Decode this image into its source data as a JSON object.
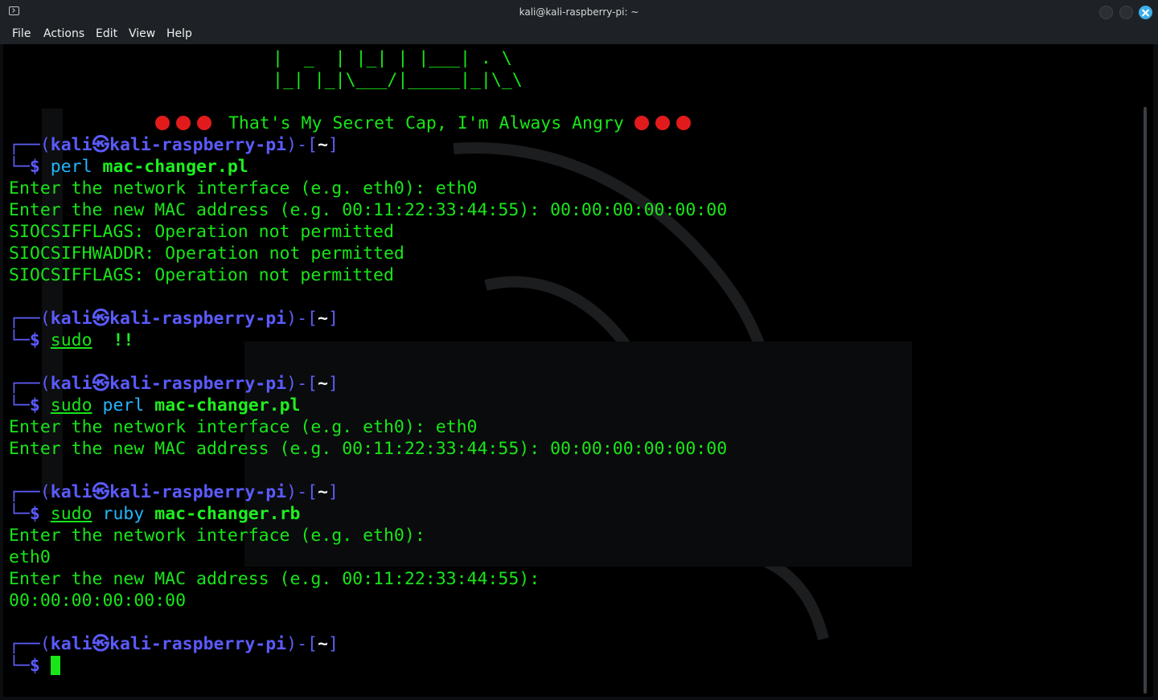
{
  "window": {
    "title": "kali@kali-raspberry-pi: ~"
  },
  "menu": [
    "File",
    "Actions",
    "Edit",
    "View",
    "Help"
  ],
  "terminal": {
    "banner": {
      "ascii1": "|  _  | |_| | |___| . \\",
      "ascii2": "|_| |_|\\___/|_____|_|\\_\\",
      "message": " That's My Secret Cap, I'm Always Angry "
    },
    "prompt": {
      "open": "┌──(",
      "user": "kali",
      "at": "㉿",
      "host": "kali-raspberry-pi",
      "mid": ")-[",
      "path": "~",
      "close": "]",
      "leader": "└─",
      "dollar": "$"
    },
    "sessions": [
      {
        "command": {
          "prefix": "",
          "interp": "perl",
          "script": "mac-changer.pl"
        },
        "output": [
          "Enter the network interface (e.g. eth0): eth0",
          "Enter the new MAC address (e.g. 00:11:22:33:44:55): 00:00:00:00:00:00",
          "SIOCSIFFLAGS: Operation not permitted",
          "SIOCSIFHWADDR: Operation not permitted",
          "SIOCSIFFLAGS: Operation not permitted"
        ]
      },
      {
        "command": {
          "prefix": "sudo",
          "interp": "",
          "script": "!!"
        },
        "output": []
      },
      {
        "command": {
          "prefix": "sudo",
          "interp": "perl",
          "script": "mac-changer.pl"
        },
        "output": [
          "Enter the network interface (e.g. eth0): eth0",
          "Enter the new MAC address (e.g. 00:11:22:33:44:55): 00:00:00:00:00:00"
        ]
      },
      {
        "command": {
          "prefix": "sudo",
          "interp": "ruby",
          "script": "mac-changer.rb"
        },
        "output": [
          "Enter the network interface (e.g. eth0):",
          "eth0",
          "Enter the new MAC address (e.g. 00:11:22:33:44:55):",
          "00:00:00:00:00:00"
        ]
      }
    ],
    "colors": {
      "text": "#18e618",
      "prompt": "#5b5bff",
      "interp": "#21b6ff",
      "dot": "#e11b1b"
    }
  }
}
